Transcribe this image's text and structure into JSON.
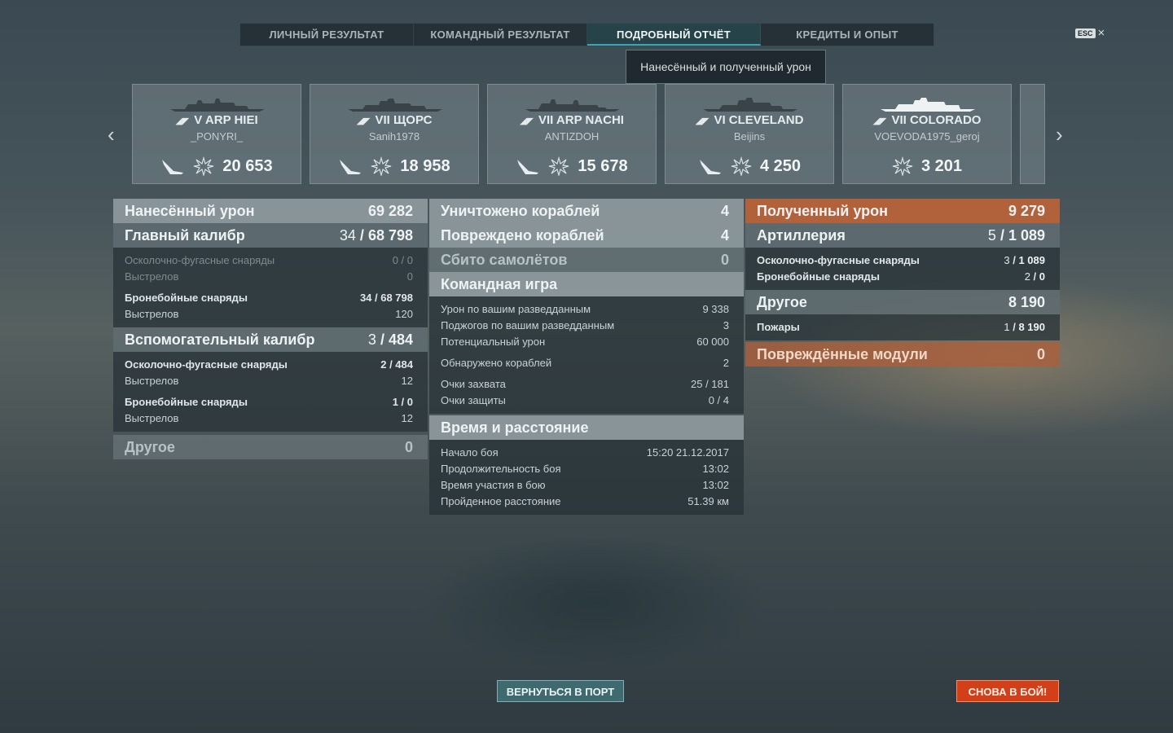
{
  "tabs": [
    {
      "label": "ЛИЧНЫЙ РЕЗУЛЬТАТ"
    },
    {
      "label": "КОМАНДНЫЙ РЕЗУЛЬТАТ"
    },
    {
      "label": "ПОДРОБНЫЙ ОТЧЁТ"
    },
    {
      "label": "КРЕДИТЫ И ОПЫТ"
    }
  ],
  "esc": {
    "key": "ESC",
    "close": "×"
  },
  "tooltip": "Нанесённый и полученный урон",
  "nav": {
    "left": "‹",
    "right": "›"
  },
  "ships": [
    {
      "tier": "V",
      "name": "ARP HIEI",
      "player": "_PONYRI_",
      "damage": "20 653"
    },
    {
      "tier": "VII",
      "name": "ЩОРС",
      "player": "Sanih1978",
      "damage": "18 958"
    },
    {
      "tier": "VII",
      "name": "ARP NACHI",
      "player": "ANTIZDOH",
      "damage": "15 678"
    },
    {
      "tier": "VI",
      "name": "CLEVELAND",
      "player": "Beijins",
      "damage": "4 250"
    },
    {
      "tier": "VII",
      "name": "COLORADO",
      "player": "VOEVODA1975_geroj",
      "damage": "3 201"
    }
  ],
  "dealt": {
    "title": "Нанесённый урон",
    "value": "69 282",
    "main": {
      "title": "Главный калибр",
      "value_a": "34",
      "value_b": "68 798",
      "he": {
        "label": "Осколочно-фугасные снаряды",
        "value": "0 / 0",
        "shots_label": "Выстрелов",
        "shots": "0"
      },
      "ap": {
        "label": "Бронебойные снаряды",
        "value": "34 / 68 798",
        "shots_label": "Выстрелов",
        "shots": "120"
      }
    },
    "secondary": {
      "title": "Вспомогательный калибр",
      "value_a": "3",
      "value_b": "484",
      "he": {
        "label": "Осколочно-фугасные снаряды",
        "value": "2 / 484",
        "shots_label": "Выстрелов",
        "shots": "12"
      },
      "ap": {
        "label": "Бронебойные снаряды",
        "value": "1 / 0",
        "shots_label": "Выстрелов",
        "shots": "12"
      }
    },
    "other": {
      "title": "Другое",
      "value": "0"
    }
  },
  "middle": {
    "destroyed": {
      "title": "Уничтожено кораблей",
      "value": "4"
    },
    "damaged": {
      "title": "Повреждено кораблей",
      "value": "4"
    },
    "planes": {
      "title": "Сбито самолётов",
      "value": "0"
    },
    "team": {
      "title": "Командная игра",
      "spotting_damage": {
        "label": "Урон по вашим разведданным",
        "value": "9 338"
      },
      "spotting_fires": {
        "label": "Поджогов по вашим разведданным",
        "value": "3"
      },
      "potential": {
        "label": "Потенциальный урон",
        "value": "60 000"
      },
      "spotted": {
        "label": "Обнаружено кораблей",
        "value": "2"
      },
      "capture": {
        "label": "Очки захвата",
        "value": "25 / 181"
      },
      "defense": {
        "label": "Очки защиты",
        "value": "0 / 4"
      }
    },
    "time": {
      "title": "Время и расстояние",
      "start": {
        "label": "Начало боя",
        "value": "15:20  21.12.2017"
      },
      "duration": {
        "label": "Продолжительность боя",
        "value": "13:02"
      },
      "participation": {
        "label": "Время участия в бою",
        "value": "13:02"
      },
      "distance": {
        "label": "Пройденное расстояние",
        "value": "51.39 км"
      }
    }
  },
  "received": {
    "title": "Полученный урон",
    "value": "9 279",
    "artillery": {
      "title": "Артиллерия",
      "value_a": "5",
      "value_b": "1 089",
      "he": {
        "label": "Осколочно-фугасные снаряды",
        "value_a": "3",
        "value_b": "1 089"
      },
      "ap": {
        "label": "Бронебойные снаряды",
        "value_a": "2",
        "value_b": "0"
      }
    },
    "other": {
      "title": "Другое",
      "value": "8 190",
      "fires": {
        "label": "Пожары",
        "value_a": "1",
        "value_b": "8 190"
      }
    },
    "modules": {
      "title": "Повреждённые модули",
      "value": "0"
    }
  },
  "buttons": {
    "port": "ВЕРНУТЬСЯ В ПОРТ",
    "battle": "СНОВА В БОЙ!"
  },
  "icons": {
    "tier": "ship-class-icon",
    "sunk": "sunk-ship-icon",
    "damage": "damage-burst-icon"
  },
  "colors": {
    "accent": "#3aa6b8",
    "orange": "#be6437",
    "battle": "#d2401a"
  }
}
